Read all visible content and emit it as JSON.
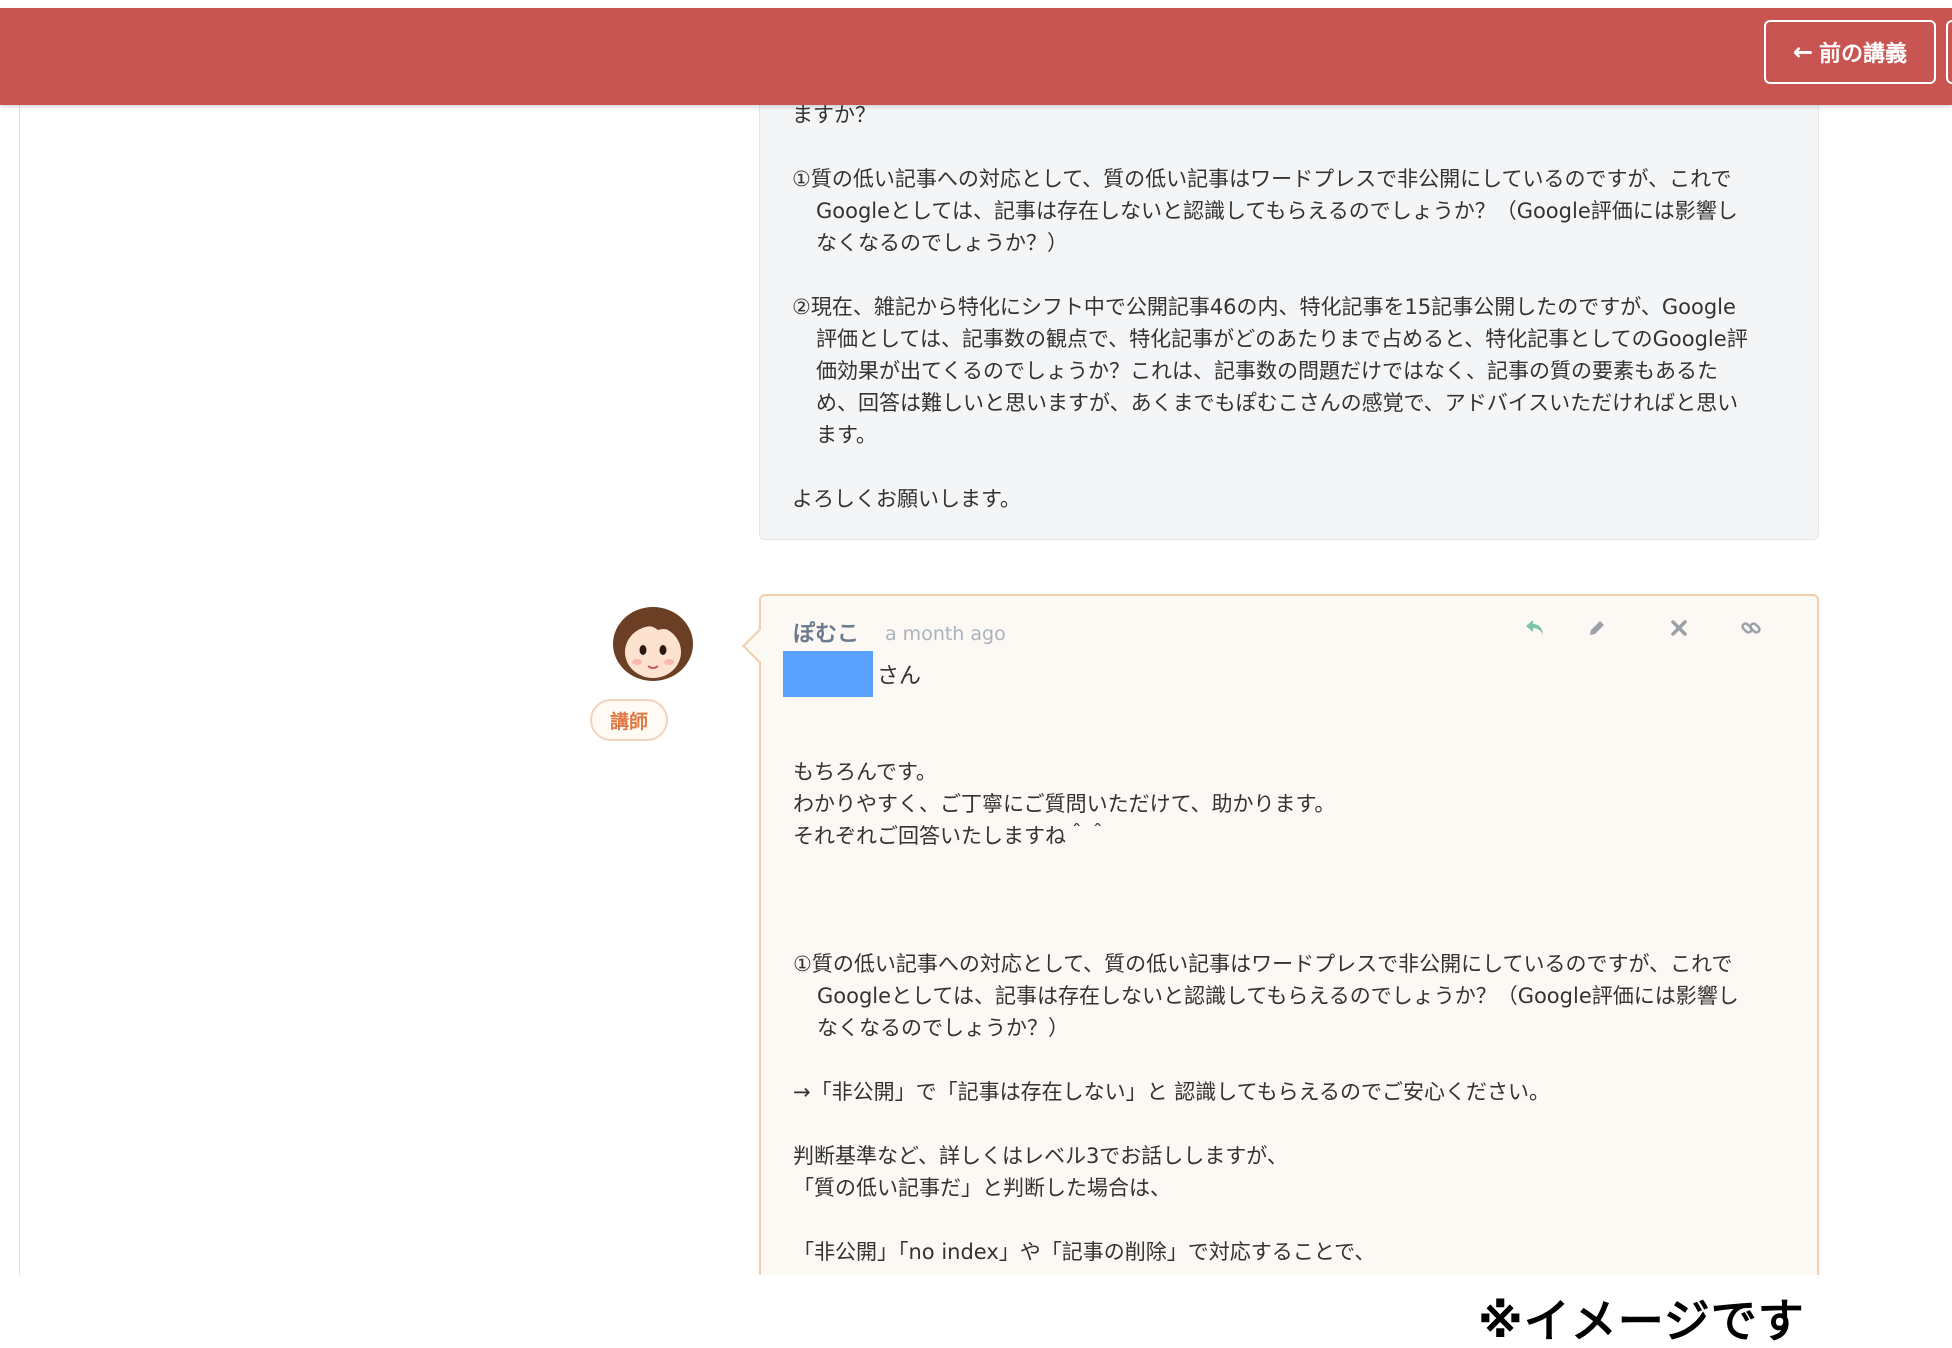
{
  "header": {
    "prev_lecture_label": "前の講義",
    "arrow_icon": "arrow-left-icon",
    "bar_color": "#c85552"
  },
  "question": {
    "lines": {
      "l0": "ますか？",
      "q1": "①質の低い記事への対応として、質の低い記事はワードプレスで非公開にしているのですが、これでGoogleとしては、記事は存在しないと認識してもらえるのでしょうか？（Google評価には影響しなくなるのでしょうか？）",
      "q2": "②現在、雑記から特化にシフト中で公開記事46の内、特化記事を15記事公開したのですが、Google評価としては、記事数の観点で、特化記事がどのあたりまで占めると、特化記事としてのGoogle評価効果が出てくるのでしょうか？これは、記事数の問題だけではなく、記事の質の要素もあるため、回答は難しいと思いますが、あくまでもぽむこさんの感覚で、アドバイスいただければと思います。",
      "closing": "よろしくお願いします。"
    }
  },
  "comment": {
    "author": "ぽむこ",
    "timestamp": "a month ago",
    "role_badge": "講師",
    "avatar_icon": "instructor-avatar-icon",
    "actions": [
      "reply-icon",
      "edit-icon",
      "delete-icon",
      "link-icon"
    ],
    "greeting_suffix": "さん",
    "body": {
      "p1": "もちろんです。",
      "p2": "わかりやすく、ご丁寧にご質問いただけて、助かります。",
      "p3": "それぞれご回答いたしますね＾＾",
      "quote": "①質の低い記事への対応として、質の低い記事はワードプレスで非公開にしているのですが、これでGoogleとしては、記事は存在しないと認識してもらえるのでしょうか？（Google評価には影響しなくなるのでしょうか？）",
      "answer": "→「非公開」で「記事は存在しない」と 認識してもらえるのでご安心ください。",
      "p4": "判断基準など、詳しくはレベル3でお話ししますが、",
      "p5": "「質の低い記事だ」と判断した場合は、",
      "p6": "「非公開」「no index」や「記事の削除」で対応することで、"
    }
  },
  "caption": "※イメージです",
  "colors": {
    "question_card_bg": "#f4f5f7",
    "reply_card_bg": "#fcf8f3",
    "reply_card_border": "#f2cfac",
    "redaction": "#5aa0ff",
    "badge_text": "#e07a45",
    "reply_icon": "#7cc6a8"
  }
}
